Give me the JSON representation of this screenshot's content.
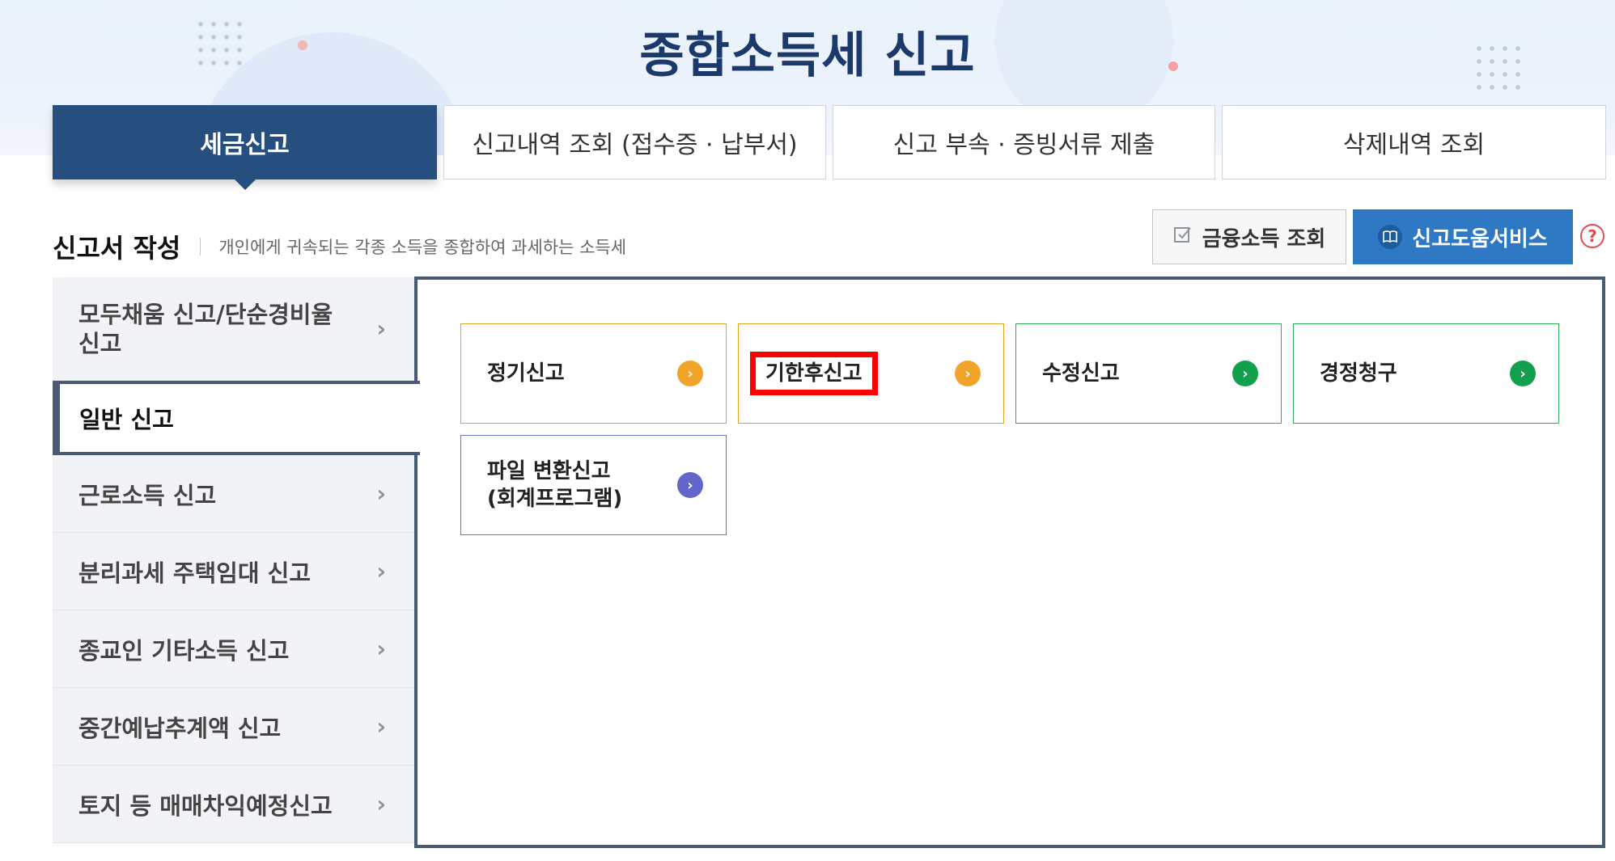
{
  "page": {
    "title": "종합소득세 신고"
  },
  "top_tabs": [
    {
      "label": "세금신고",
      "active": true
    },
    {
      "label": "신고내역 조회 (접수증 · 납부서)",
      "active": false
    },
    {
      "label": "신고 부속 · 증빙서류 제출",
      "active": false
    },
    {
      "label": "삭제내역 조회",
      "active": false
    }
  ],
  "section": {
    "title": "신고서 작성",
    "desc": "개인에게 귀속되는 각종 소득을 종합하여 과세하는 소득세"
  },
  "actions": {
    "financial_income": "금융소득 조회",
    "help_service": "신고도움서비스",
    "help_icon": "?"
  },
  "sidebar": [
    {
      "label": "모두채움 신고/단순경비율 신고",
      "active": false
    },
    {
      "label": "일반 신고",
      "active": true
    },
    {
      "label": "근로소득 신고",
      "active": false
    },
    {
      "label": "분리과세 주택임대 신고",
      "active": false
    },
    {
      "label": "종교인 기타소득 신고",
      "active": false
    },
    {
      "label": "중간예납추계액 신고",
      "active": false
    },
    {
      "label": "토지 등 매매차익예정신고",
      "active": false
    }
  ],
  "cards": [
    {
      "label": "정기신고",
      "color": "#f2a42a"
    },
    {
      "label": "기한후신고",
      "color": "#f2a42a",
      "highlighted": true
    },
    {
      "label": "수정신고",
      "color": "#12a04c"
    },
    {
      "label": "경정청구",
      "color": "#12a04c"
    },
    {
      "label_line1": "파일 변환신고",
      "label_line2": "(회계프로그램)",
      "color": "#6366c9"
    }
  ],
  "icons": {
    "chevron": "›",
    "arrow": "›",
    "check": "check-icon",
    "book": "book-icon"
  }
}
